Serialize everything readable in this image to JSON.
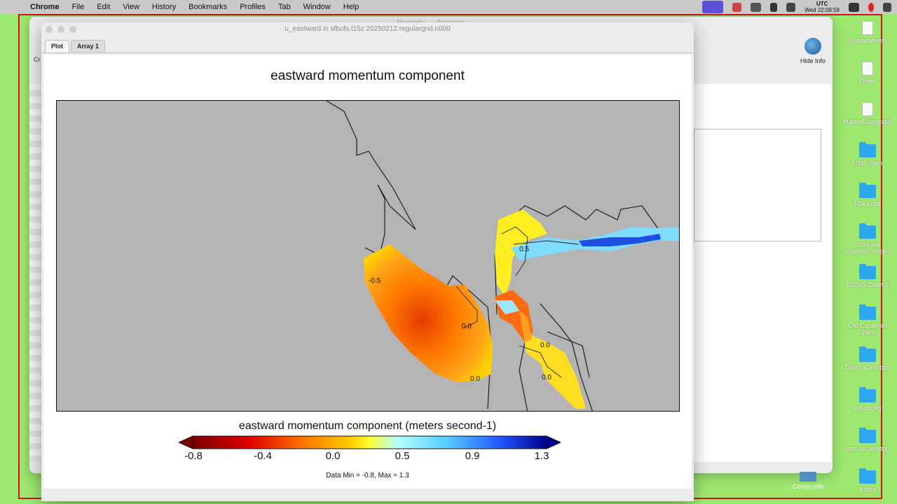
{
  "menubar": {
    "app": "Chrome",
    "items": [
      "File",
      "Edit",
      "View",
      "History",
      "Bookmarks",
      "Profiles",
      "Tab",
      "Window",
      "Help"
    ],
    "clock_tz": "UTC",
    "clock_time": "Wed 22:08:59"
  },
  "background_window": {
    "title": "Panoply — Sources",
    "hide_info_label": "Hide Info"
  },
  "plot_window": {
    "title": "u_eastward in sfbofs.t15z.20250212.regulargrid.n000",
    "tabs": [
      "Plot",
      "Array 1"
    ],
    "plot_title": "eastward momentum component",
    "colorbar_title": "eastward momentum component (meters second-1)",
    "colorbar_ticks": [
      "-0.8",
      "-0.4",
      "0.0",
      "0.5",
      "0.9",
      "1.3"
    ],
    "data_range": "Data Min = -0.8, Max = 1.3",
    "colors": {
      "land": "#b4b4b4",
      "colormap": [
        "#7a0000",
        "#e00000",
        "#ff7a00",
        "#ffd000",
        "#ffff33",
        "#b4ffff",
        "#55ccff",
        "#2255ff",
        "#00008b"
      ]
    },
    "contour_labels": [
      "-0.5",
      "0.0",
      "0.0",
      "0.5",
      "0.0",
      "0.0"
    ]
  },
  "desktop_icons": [
    "Spreadsheets",
    "Other",
    "MarineBarograph",
    "USB_Baro",
    "N2k Logs",
    "compass conversi...book 4",
    "ECDIS-Chart 1",
    "Old Canadian Charts",
    "David xDropbox",
    "wifi config",
    "was on desktop",
    "tcdata"
  ],
  "condo_label": "Condo Info"
}
